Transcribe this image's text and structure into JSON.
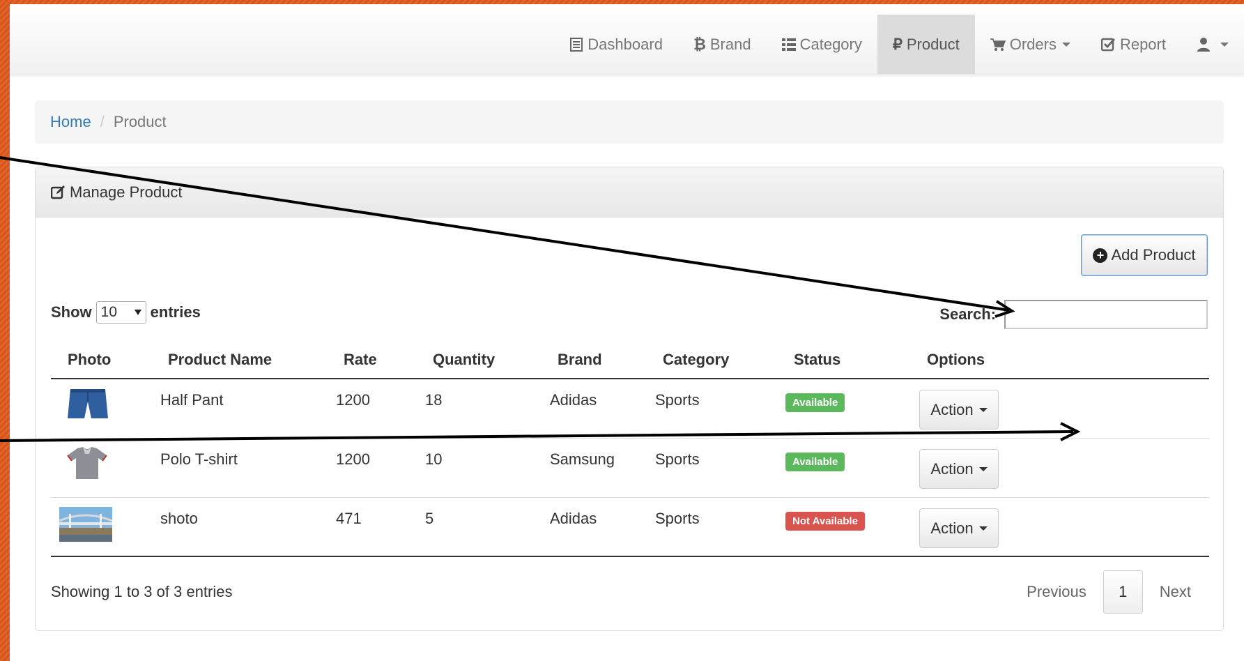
{
  "nav": {
    "items": [
      {
        "label": "Dashboard",
        "icon": "list-icon"
      },
      {
        "label": "Brand",
        "icon": "bitcoin-icon"
      },
      {
        "label": "Category",
        "icon": "th-list-icon"
      },
      {
        "label": "Product",
        "icon": "ruble-icon",
        "active": true
      },
      {
        "label": "Orders",
        "icon": "cart-icon",
        "dropdown": true
      },
      {
        "label": "Report",
        "icon": "check-icon"
      },
      {
        "label": "",
        "icon": "user-icon",
        "dropdown": true
      }
    ]
  },
  "breadcrumb": {
    "home": "Home",
    "separator": "/",
    "current": "Product"
  },
  "panel": {
    "title": "Manage Product"
  },
  "add_button": "Add Product",
  "length": {
    "show": "Show",
    "value": "10",
    "entries": "entries"
  },
  "search": {
    "label": "Search:",
    "value": ""
  },
  "table": {
    "headers": [
      "Photo",
      "Product Name",
      "Rate",
      "Quantity",
      "Brand",
      "Category",
      "Status",
      "Options"
    ],
    "rows": [
      {
        "photo": "shorts-photo",
        "name": "Half Pant",
        "rate": "1200",
        "quantity": "18",
        "brand": "Adidas",
        "category": "Sports",
        "status": "Available",
        "action": "Action"
      },
      {
        "photo": "tshirt-photo",
        "name": "Polo T-shirt",
        "rate": "1200",
        "quantity": "10",
        "brand": "Samsung",
        "category": "Sports",
        "status": "Available",
        "action": "Action"
      },
      {
        "photo": "bridge-photo",
        "name": "shoto",
        "rate": "471",
        "quantity": "5",
        "brand": "Adidas",
        "category": "Sports",
        "status": "Not Available",
        "action": "Action"
      }
    ]
  },
  "footer": {
    "info": "Showing 1 to 3 of 3 entries",
    "previous": "Previous",
    "page": "1",
    "next": "Next"
  },
  "colors": {
    "available": "#5cb85c",
    "not_available": "#d9534f",
    "link": "#337ab7",
    "accent_border": "#d9541a"
  }
}
